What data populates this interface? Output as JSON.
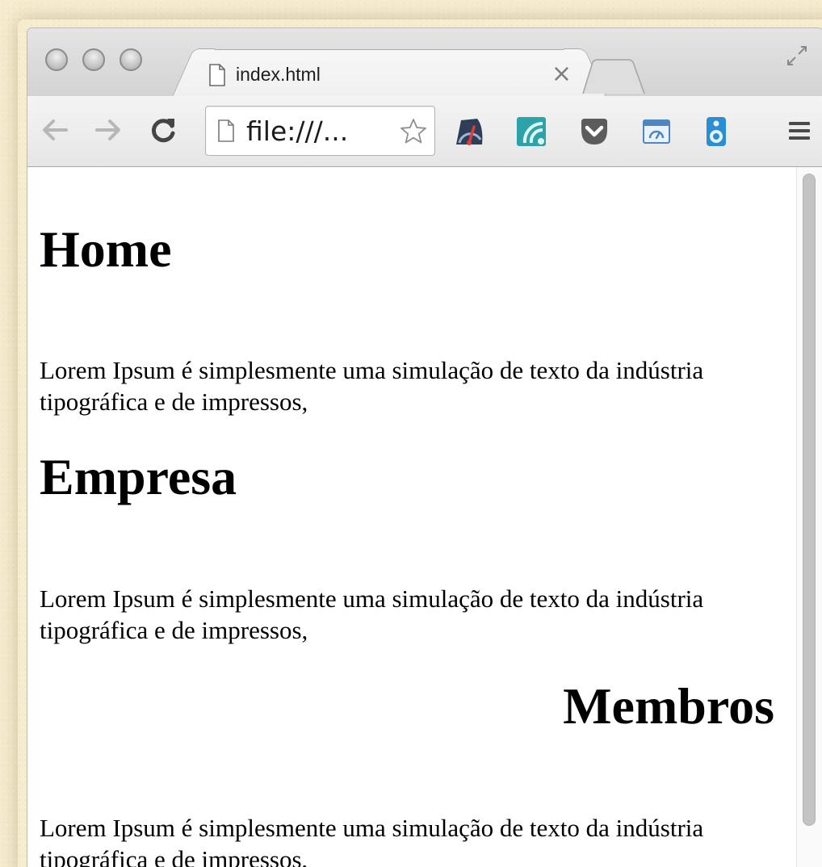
{
  "browser": {
    "tab": {
      "title": "index.html",
      "close_glyph": "×",
      "icon": "file-icon"
    },
    "new_tab_icon": "new-tab-icon",
    "fullscreen_icon": "fullscreen-icon",
    "toolbar": {
      "back_icon": "back-arrow-icon",
      "forward_icon": "forward-arrow-icon",
      "reload_icon": "reload-icon",
      "address_value": "file:///...",
      "bookmark_icon": "star-icon",
      "extensions": [
        "speedometer-extension-icon",
        "wave-extension-icon",
        "pocket-extension-icon",
        "window-extension-icon",
        "speaker-extension-icon"
      ],
      "menu_icon": "hamburger-menu-icon"
    }
  },
  "page": {
    "sections": [
      {
        "heading": "Home",
        "text": "Lorem Ipsum é simplesmente uma simulação de texto da indústria tipográfica e de impressos,"
      },
      {
        "heading": "Empresa",
        "text": "Lorem Ipsum é simplesmente uma simulação de texto da indústria tipográfica e de impressos,"
      },
      {
        "heading": "Membros",
        "text": "Lorem Ipsum é simplesmente uma simulação de texto da indústria tipográfica e de impressos,"
      }
    ]
  },
  "colors": {
    "desktop_background": "#f6eccf",
    "chrome_frame": "#dcdcdc",
    "page_background": "#ffffff",
    "text": "#000000",
    "scrollbar_thumb": "#c3c3c3"
  }
}
